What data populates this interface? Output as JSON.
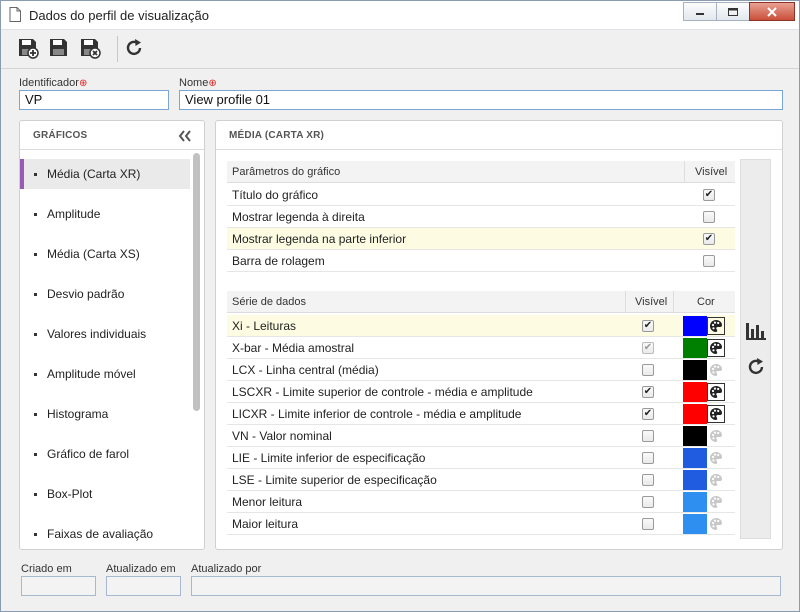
{
  "window": {
    "title": "Dados do perfil de visualização"
  },
  "form": {
    "identifier_label": "Identificador",
    "identifier_value": "VP",
    "name_label": "Nome",
    "name_value": "View profile 01"
  },
  "left_panel": {
    "title": "GRÁFICOS",
    "items": [
      {
        "label": "Média (Carta XR)",
        "active": true
      },
      {
        "label": "Amplitude"
      },
      {
        "label": "Média (Carta XS)"
      },
      {
        "label": "Desvio padrão"
      },
      {
        "label": "Valores individuais"
      },
      {
        "label": "Amplitude móvel"
      },
      {
        "label": "Histograma"
      },
      {
        "label": "Gráfico de farol"
      },
      {
        "label": "Box-Plot"
      },
      {
        "label": "Faixas de avaliação"
      }
    ]
  },
  "right_panel": {
    "title": "MÉDIA (CARTA XR)",
    "params_table": {
      "col_param": "Parâmetros do gráfico",
      "col_visible": "Visível",
      "rows": [
        {
          "label": "Título do gráfico",
          "checked": true
        },
        {
          "label": "Mostrar legenda à direita",
          "checked": false
        },
        {
          "label": "Mostrar legenda na parte inferior",
          "checked": true,
          "highlight": true
        },
        {
          "label": "Barra de rolagem",
          "checked": false
        }
      ]
    },
    "series_table": {
      "col_series": "Série de dados",
      "col_visible": "Visível",
      "col_color": "Cor",
      "rows": [
        {
          "label": "Xi - Leituras",
          "checked": true,
          "color": "#0000ff",
          "pal_active": true,
          "highlight": true
        },
        {
          "label": "X-bar - Média amostral",
          "checked": true,
          "dim": true,
          "color": "#008000",
          "pal_active": true
        },
        {
          "label": "LCX - Linha central (média)",
          "checked": false,
          "color": "#000000",
          "pal_active": false
        },
        {
          "label": "LSCXR - Limite superior de controle - média e amplitude",
          "checked": true,
          "color": "#ff0000",
          "pal_active": true
        },
        {
          "label": "LICXR - Limite inferior de controle - média e amplitude",
          "checked": true,
          "color": "#ff0000",
          "pal_active": true
        },
        {
          "label": "VN - Valor nominal",
          "checked": false,
          "color": "#000000",
          "pal_active": false
        },
        {
          "label": "LIE - Limite inferior de especificação",
          "checked": false,
          "color": "#1f5ce0",
          "pal_active": false
        },
        {
          "label": "LSE - Limite superior de especificação",
          "checked": false,
          "color": "#1f5ce0",
          "pal_active": false
        },
        {
          "label": "Menor leitura",
          "checked": false,
          "color": "#2f8ff0",
          "pal_active": false
        },
        {
          "label": "Maior leitura",
          "checked": false,
          "color": "#2f8ff0",
          "pal_active": false
        }
      ]
    }
  },
  "footer": {
    "created_label": "Criado em",
    "updated_label": "Atualizado em",
    "updated_by_label": "Atualizado por"
  },
  "icons": {
    "save_new": "save-new-icon",
    "save": "save-icon",
    "save_close": "save-close-icon",
    "refresh": "refresh-icon",
    "collapse": "double-chevron-left-icon",
    "chart": "bar-chart-icon",
    "reset": "refresh-icon"
  }
}
